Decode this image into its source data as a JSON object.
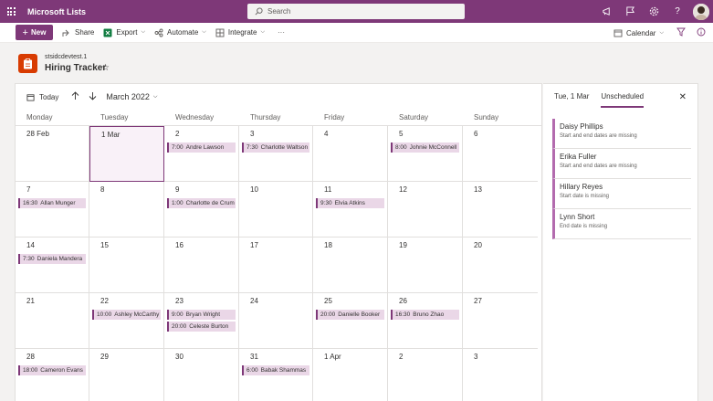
{
  "suite": {
    "app_name": "Microsoft Lists",
    "search_placeholder": "Search",
    "icons": [
      "megaphone-icon",
      "flag-icon",
      "gear-icon",
      "help-icon"
    ],
    "help_glyph": "?"
  },
  "cmdbar": {
    "new_label": "New",
    "share_label": "Share",
    "export_label": "Export",
    "automate_label": "Automate",
    "integrate_label": "Integrate",
    "more_label": "···",
    "view_label": "Calendar"
  },
  "title": {
    "site_name": "stsidcdevtest.1",
    "list_name": "Hiring Tracker"
  },
  "calendar": {
    "today_label": "Today",
    "month_label": "March 2022",
    "weekdays": [
      "Monday",
      "Tuesday",
      "Wednesday",
      "Thursday",
      "Friday",
      "Saturday",
      "Sunday"
    ],
    "weeks": [
      [
        {
          "day": "28 Feb",
          "events": []
        },
        {
          "day": "1 Mar",
          "today": true,
          "events": []
        },
        {
          "day": "2",
          "events": [
            {
              "time": "7:00",
              "name": "Andre Lawson"
            }
          ]
        },
        {
          "day": "3",
          "events": [
            {
              "time": "7:30",
              "name": "Charlotte Waltson"
            }
          ]
        },
        {
          "day": "4",
          "events": []
        },
        {
          "day": "5",
          "events": [
            {
              "time": "8:00",
              "name": "Johnie McConnell"
            }
          ]
        },
        {
          "day": "6",
          "events": []
        }
      ],
      [
        {
          "day": "7",
          "events": [
            {
              "time": "16:30",
              "name": "Allan Munger"
            }
          ]
        },
        {
          "day": "8",
          "events": []
        },
        {
          "day": "9",
          "events": [
            {
              "time": "1:00",
              "name": "Charlotte de Crum"
            }
          ]
        },
        {
          "day": "10",
          "events": []
        },
        {
          "day": "11",
          "events": [
            {
              "time": "9:30",
              "name": "Elvia Atkins"
            }
          ]
        },
        {
          "day": "12",
          "events": []
        },
        {
          "day": "13",
          "events": []
        }
      ],
      [
        {
          "day": "14",
          "events": [
            {
              "time": "7:30",
              "name": "Daniela Mandera"
            }
          ]
        },
        {
          "day": "15",
          "events": []
        },
        {
          "day": "16",
          "events": []
        },
        {
          "day": "17",
          "events": []
        },
        {
          "day": "18",
          "events": []
        },
        {
          "day": "19",
          "events": []
        },
        {
          "day": "20",
          "events": []
        }
      ],
      [
        {
          "day": "21",
          "events": []
        },
        {
          "day": "22",
          "events": [
            {
              "time": "10:00",
              "name": "Ashley McCarthy"
            }
          ]
        },
        {
          "day": "23",
          "events": [
            {
              "time": "9:00",
              "name": "Bryan Wright"
            },
            {
              "time": "20:00",
              "name": "Celeste Burton"
            }
          ]
        },
        {
          "day": "24",
          "events": []
        },
        {
          "day": "25",
          "events": [
            {
              "time": "20:00",
              "name": "Danielle Booker"
            }
          ]
        },
        {
          "day": "26",
          "events": [
            {
              "time": "16:30",
              "name": "Bruno Zhao"
            }
          ]
        },
        {
          "day": "27",
          "events": []
        }
      ],
      [
        {
          "day": "28",
          "events": [
            {
              "time": "18:00",
              "name": "Cameron Evans"
            }
          ]
        },
        {
          "day": "29",
          "events": []
        },
        {
          "day": "30",
          "events": []
        },
        {
          "day": "31",
          "events": [
            {
              "time": "6:00",
              "name": "Babak Shammas"
            }
          ]
        },
        {
          "day": "1 Apr",
          "events": []
        },
        {
          "day": "2",
          "events": []
        },
        {
          "day": "3",
          "events": []
        }
      ]
    ]
  },
  "side_panel": {
    "tab_date": "Tue, 1 Mar",
    "tab_unscheduled": "Unscheduled",
    "items": [
      {
        "name": "Daisy Phillips",
        "note": "Start and end dates are missing"
      },
      {
        "name": "Erika Fuller",
        "note": "Start and end dates are missing"
      },
      {
        "name": "Hillary Reyes",
        "note": "Start date is missing"
      },
      {
        "name": "Lynn Short",
        "note": "End date is missing"
      }
    ]
  },
  "colors": {
    "brand": "#7e3878",
    "event_bg": "#ead7e7",
    "list_icon": "#d83b01"
  }
}
